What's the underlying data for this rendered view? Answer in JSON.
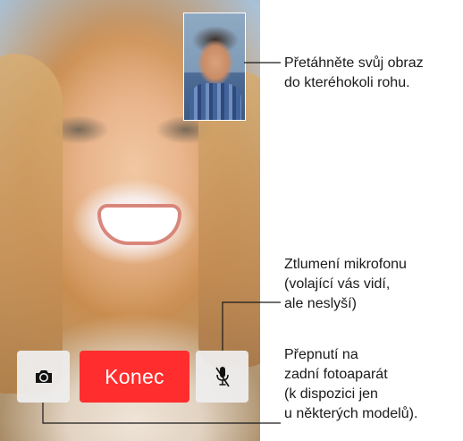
{
  "call_controls": {
    "end_label": "Konec",
    "flip_camera_icon": "camera-flip-icon",
    "mute_icon": "microphone-mute-icon"
  },
  "self_view": {
    "description_icon": "self-view-video"
  },
  "annotations": {
    "drag_pip": [
      "Přetáhněte svůj obraz",
      "do kteréhokoli rohu."
    ],
    "mute": [
      "Ztlumení mikrofonu",
      "(volající vás vidí,",
      "ale neslyší)"
    ],
    "flip": [
      "Přepnutí na",
      "zadní fotoaparát",
      "(k dispozici jen",
      "u některých modelů)."
    ]
  },
  "colors": {
    "end_button": "#ff2d2d",
    "control_button_bg": "#eeeeee",
    "callout_line": "#1a1a1a"
  }
}
